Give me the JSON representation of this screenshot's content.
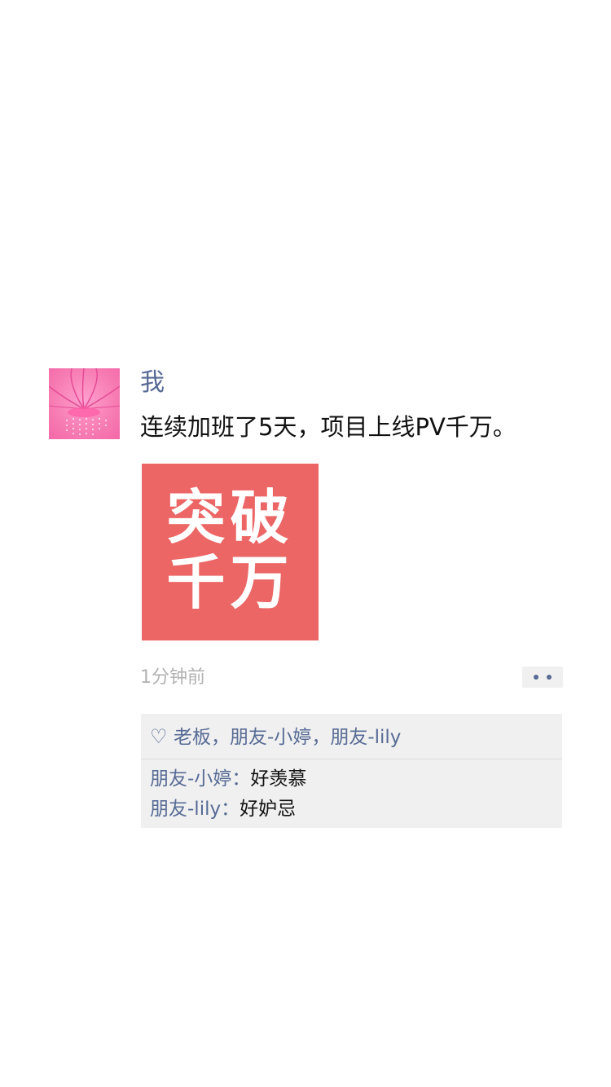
{
  "post": {
    "author": "我",
    "text": "连续加班了5天，项目上线PV千万。",
    "image": {
      "line1": "突破",
      "line2": "千万",
      "background": "#ec6665"
    },
    "time": "1分钟前",
    "likes": {
      "icon": "heart-icon",
      "heart_glyph": "♡",
      "names": [
        "老板",
        "朋友-小婷",
        "朋友-lily"
      ],
      "separator": "，"
    },
    "comments": [
      {
        "author": "朋友-小婷",
        "separator": "：",
        "text": "好羡慕"
      },
      {
        "author": "朋友-lily",
        "separator": "：",
        "text": "好妒忌"
      }
    ]
  },
  "colors": {
    "link": "#576b95",
    "text": "#111111",
    "muted": "#b2b2b2",
    "panel": "#f0f0f0",
    "avatar_pink": "#f77eb4"
  }
}
